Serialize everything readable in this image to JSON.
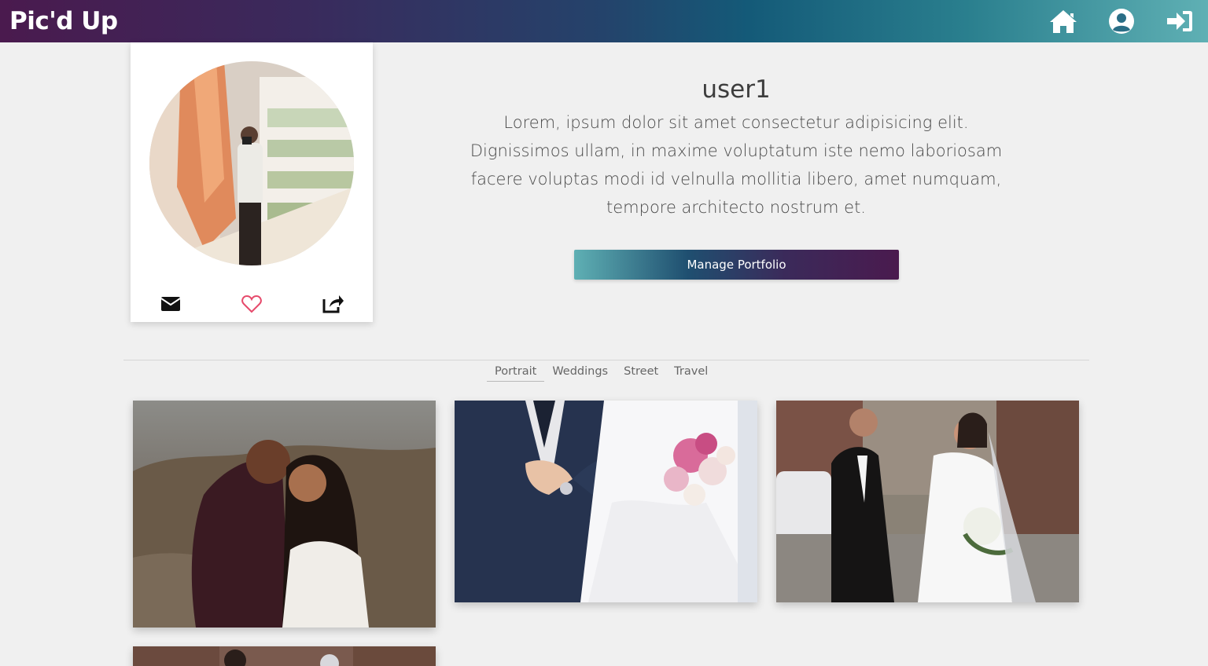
{
  "app": {
    "brand": "Pic'd Up"
  },
  "nav": {
    "icons": [
      "home-icon",
      "user-circle-icon",
      "sign-in-icon"
    ]
  },
  "profile": {
    "username": "user1",
    "bio": "Lorem, ipsum dolor sit amet consectetur adipisicing elit. Dignissimos ullam, in maxime voluptatum iste nemo laboriosam facere voluptas modi id velnulla mollitia libero, amet numquam, tempore architecto nostrum et.",
    "bio_lines": [
      "Lorem, ipsum dolor sit amet consectetur adipisicing elit.",
      "Dignissimos ullam, in maxime voluptatum iste nemo laboriosam",
      "facere voluptas modi id velnulla mollitia libero, amet numquam,",
      "tempore architecto nostrum et."
    ],
    "actions": [
      "envelope-icon",
      "heart-icon",
      "share-icon"
    ],
    "manage_label": "Manage Portfolio"
  },
  "tabs": [
    "Portrait",
    "Weddings",
    "Street",
    "Travel"
  ],
  "active_tab": "Portrait",
  "gallery": {
    "photos": [
      "wedding-couple-photo",
      "wedding-bouquet-photo",
      "wedding-walk-photo",
      "wedding-photo-partial"
    ]
  },
  "colors": {
    "accent_teal": "#5fb0b4",
    "accent_purple": "#4a1a4e",
    "heart": "#e64a6b"
  }
}
